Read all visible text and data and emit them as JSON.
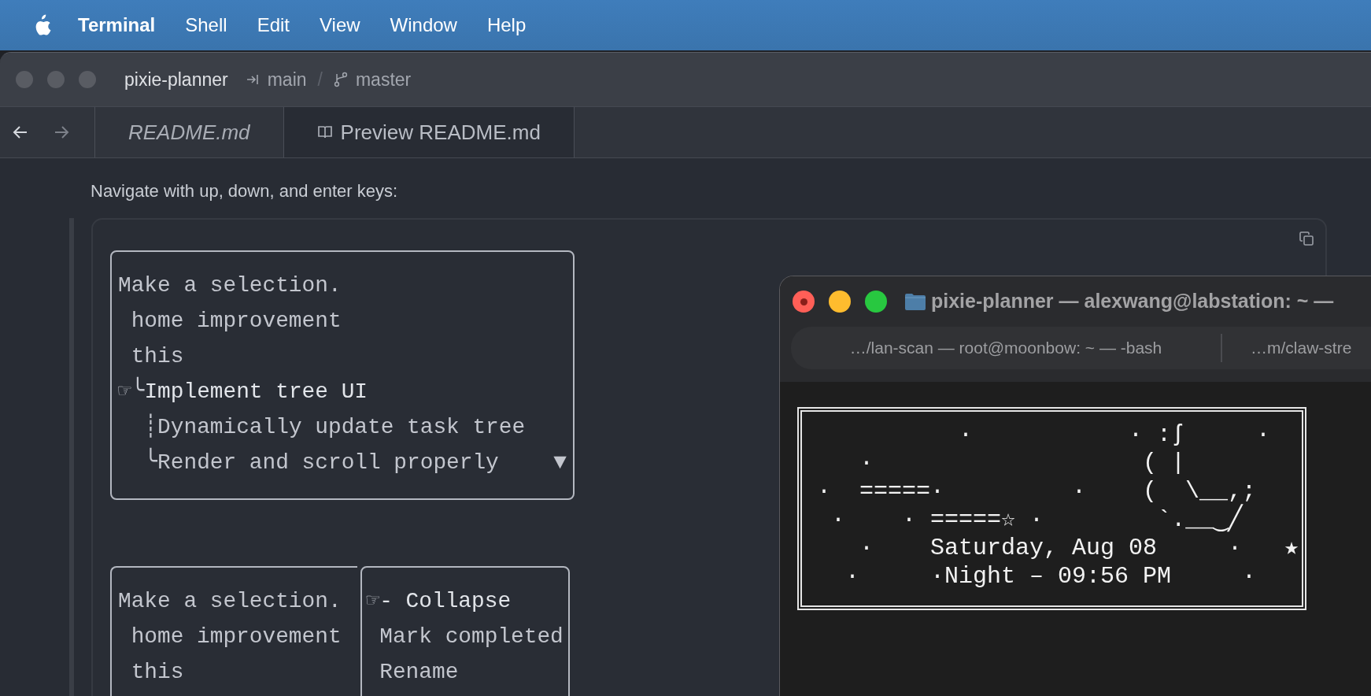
{
  "menu_bar": {
    "app": "Terminal",
    "items": [
      "Shell",
      "Edit",
      "View",
      "Window",
      "Help"
    ]
  },
  "editor": {
    "focused": false,
    "project": "pixie-planner",
    "worktree": "main",
    "separator": "/",
    "branch": "master",
    "tabs": [
      {
        "label": "README.md",
        "kind": "file",
        "selected": false
      },
      {
        "label": "Preview README.md",
        "kind": "preview",
        "selected": true
      }
    ],
    "intro": "Navigate with up, down, and enter keys:",
    "code_block": {
      "cursor": "☞",
      "screens": [
        {
          "boxes": [
            {
              "prompt": "Make a selection.",
              "scroll_indicator": "▼",
              "items": [
                {
                  "label": "home improvement",
                  "selected": false
                },
                {
                  "label": "this",
                  "selected": false
                },
                {
                  "label": "Implement tree UI",
                  "branch": "╰",
                  "selected": true,
                  "children": [
                    {
                      "label": "Dynamically update task tree",
                      "branch": "┊",
                      "selected": false
                    },
                    {
                      "label": "Render and scroll properly",
                      "branch": "╰",
                      "selected": false
                    }
                  ]
                }
              ]
            }
          ]
        },
        {
          "boxes": [
            {
              "prompt": "Make a selection.",
              "items": [
                {
                  "label": "home improvement",
                  "selected": false
                },
                {
                  "label": "this",
                  "selected": false
                }
              ]
            },
            {
              "items": [
                {
                  "label": "- Collapse",
                  "selected": true
                },
                {
                  "label": "Mark completed",
                  "selected": false
                },
                {
                  "label": "Rename",
                  "selected": false
                }
              ]
            }
          ]
        }
      ]
    }
  },
  "terminal": {
    "focused": true,
    "title": "pixie-planner — alexwang@labstation: ~ —",
    "tabs": [
      "…/lan-scan — root@moonbow: ~ — -bash",
      "…m/claw-stre"
    ],
    "art_lines": [
      "           ·           · :ʃ     ·",
      "    ·                   ( |",
      " ·  =====·         ·    (  \\__,;",
      "  ·    · =====☆ ·        `.__‿╱",
      "    ·    Saturday, Aug 08     ·   ★",
      "   ·     ·Night – 09:56 PM     ·"
    ]
  }
}
